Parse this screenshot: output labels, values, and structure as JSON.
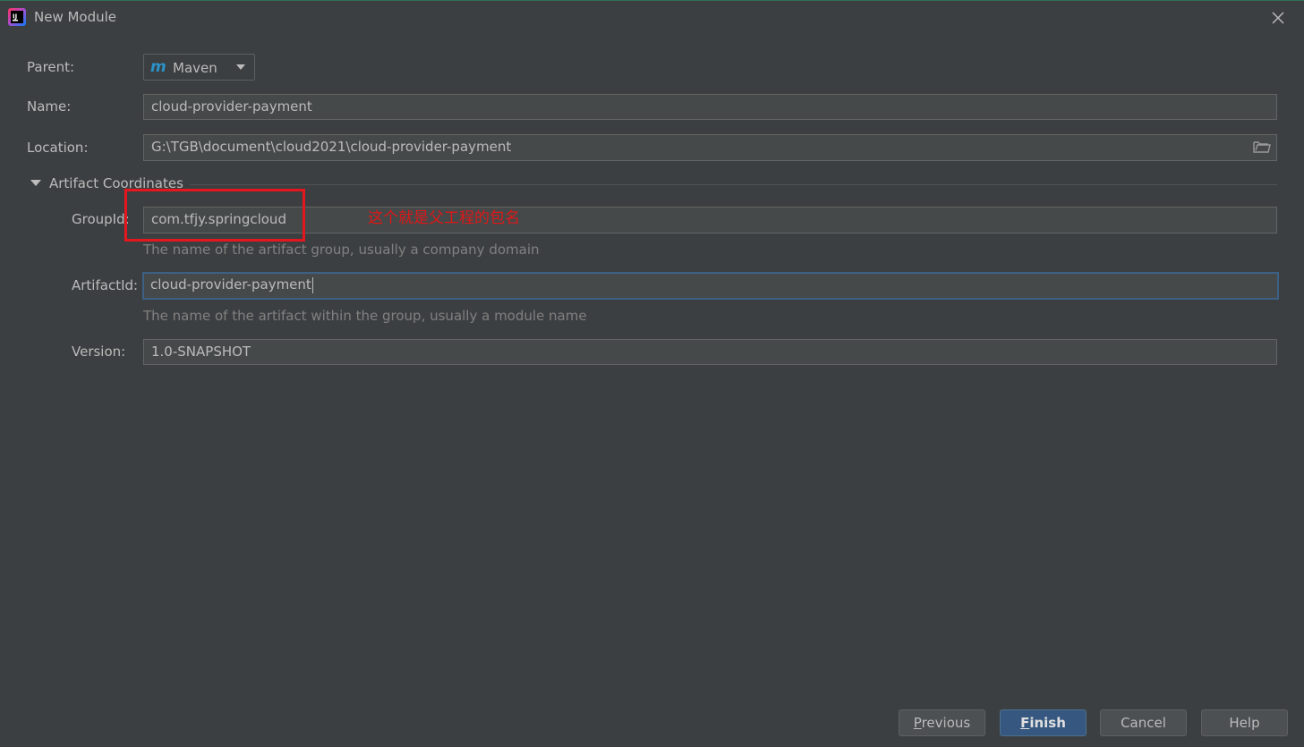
{
  "window": {
    "title": "New Module"
  },
  "form": {
    "parent_label": "Parent:",
    "parent_value": "Maven",
    "name_label": "Name:",
    "name_value": "cloud-provider-payment",
    "location_label": "Location:",
    "location_value": "G:\\TGB\\document\\cloud2021\\cloud-provider-payment"
  },
  "artifact": {
    "section_title": "Artifact Coordinates",
    "groupid_label": "GroupId:",
    "groupid_value": "com.tfjy.springcloud",
    "groupid_hint": "The name of the artifact group, usually a company domain",
    "artifactid_label": "ArtifactId:",
    "artifactid_value": "cloud-provider-payment",
    "artifactid_hint": "The name of the artifact within the group, usually a module name",
    "version_label": "Version:",
    "version_value": "1.0-SNAPSHOT"
  },
  "annotation": {
    "note": "这个就是父工程的包名",
    "color": "#e5171e"
  },
  "buttons": {
    "previous_mnemonic": "P",
    "previous_rest": "revious",
    "finish_mnemonic": "F",
    "finish_rest": "inish",
    "cancel": "Cancel",
    "help": "Help"
  },
  "colors": {
    "background": "#3c3f41",
    "field_bg": "#45494a",
    "primary_button": "#365880",
    "focus_border": "#3d6185",
    "maven_icon": "#2a93c9"
  },
  "icons": {
    "app": "intellij-idea-icon",
    "close": "close-icon",
    "parent": "maven-icon",
    "browse": "folder-icon",
    "section": "triangle-down-icon"
  }
}
